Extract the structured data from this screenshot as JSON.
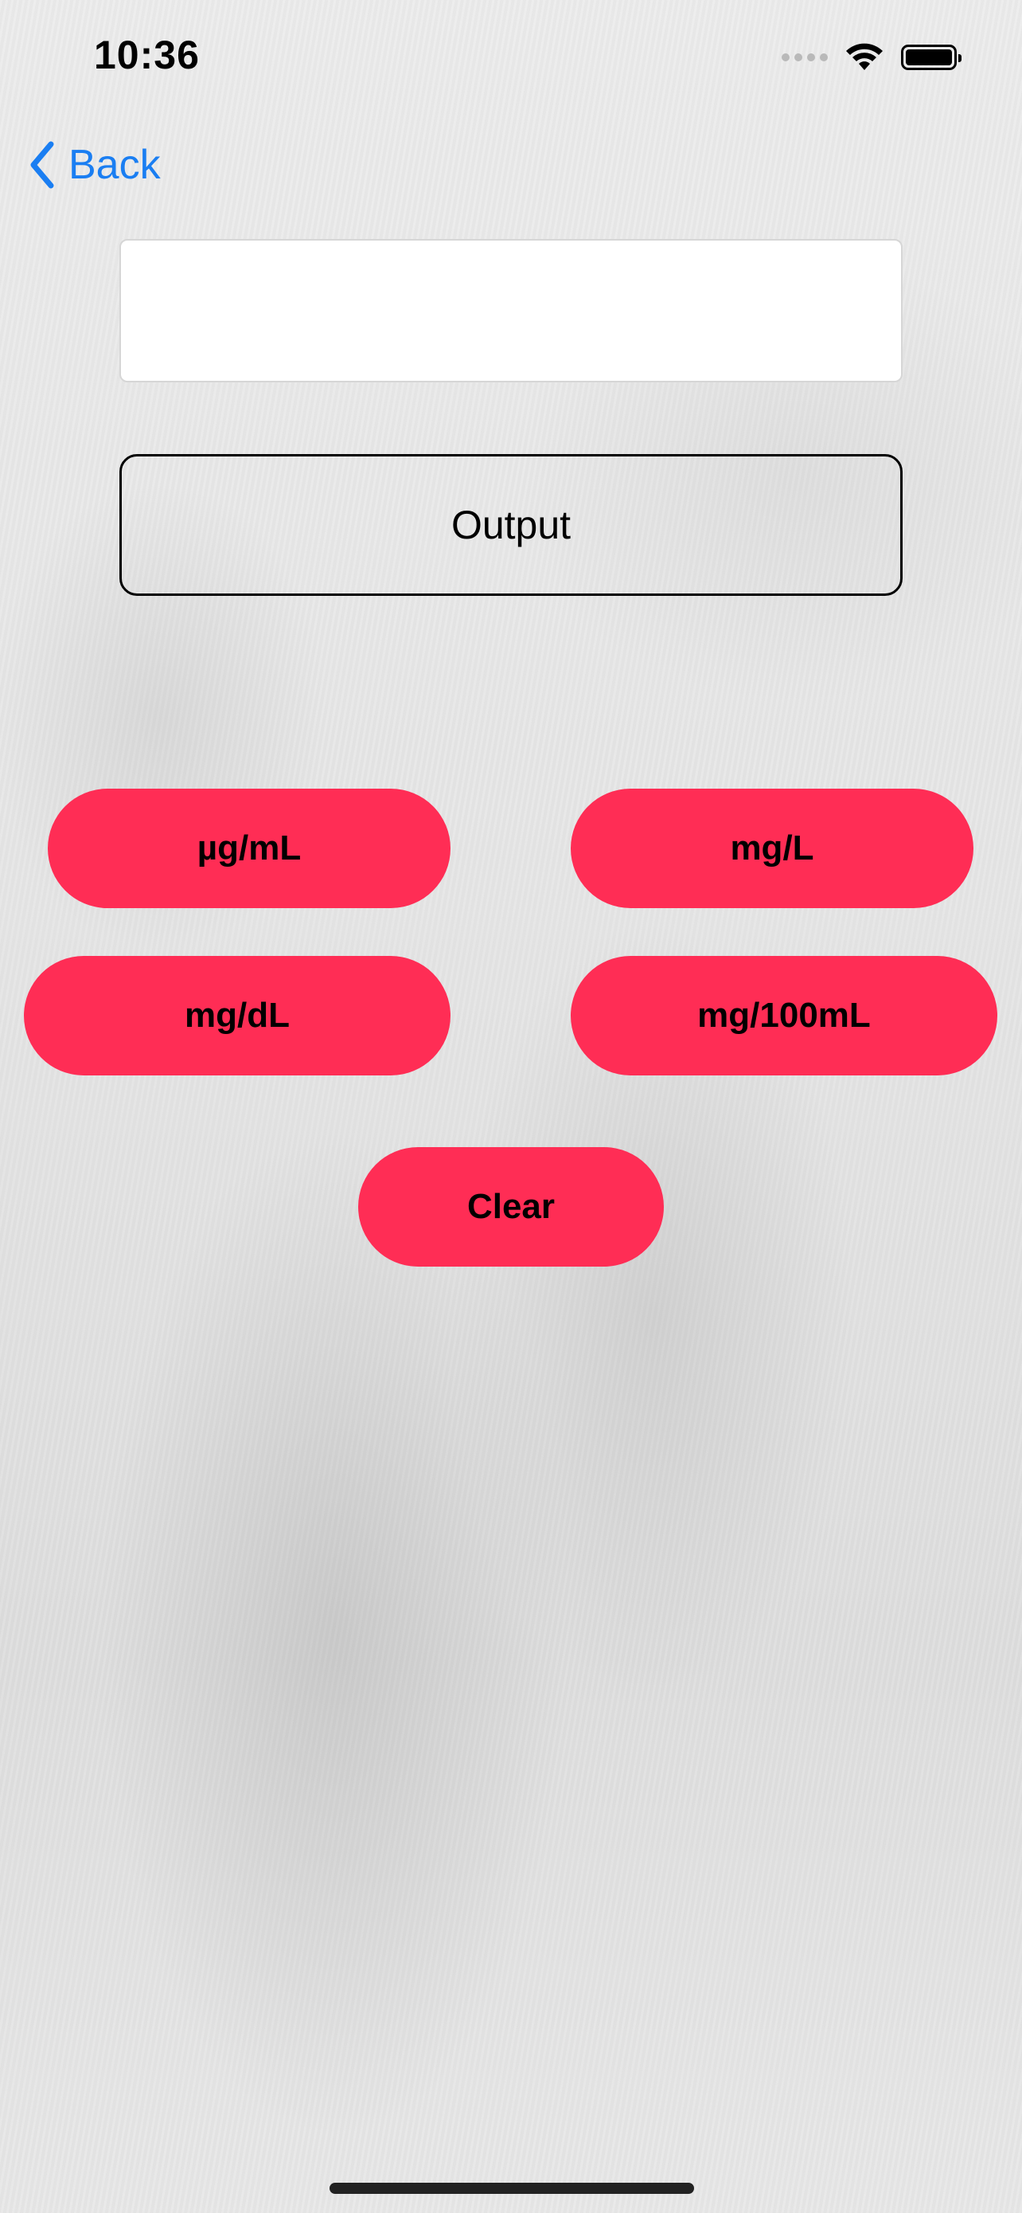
{
  "status_bar": {
    "time": "10:36",
    "icons": [
      "cellular-signal-icon",
      "wifi-icon",
      "battery-icon"
    ]
  },
  "nav": {
    "back_label": "Back",
    "accent_color": "#1a7ef2"
  },
  "input": {
    "value": "",
    "placeholder": ""
  },
  "output": {
    "label": "Output"
  },
  "unit_buttons": {
    "color": "#ff2d55",
    "ug_per_ml": "µg/mL",
    "mg_per_l": "mg/L",
    "mg_per_dl": "mg/dL",
    "mg_per_100ml": "mg/100mL"
  },
  "clear_label": "Clear"
}
